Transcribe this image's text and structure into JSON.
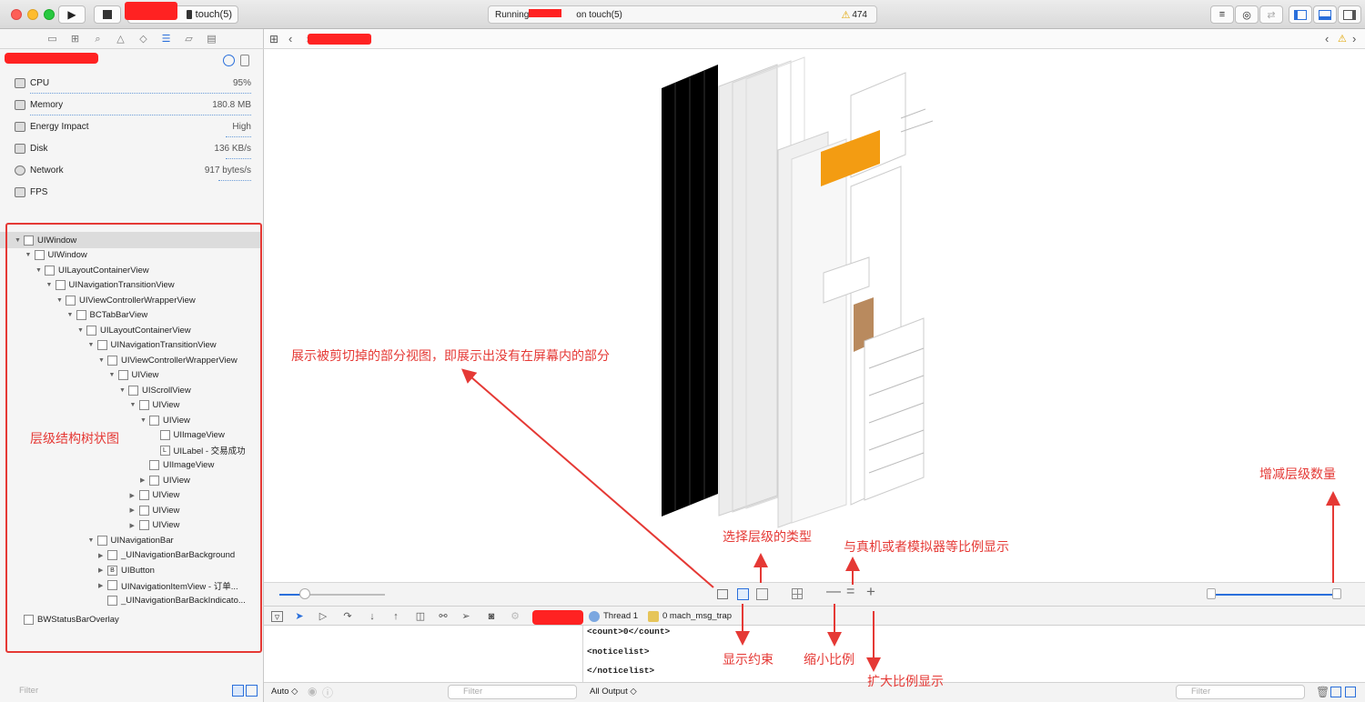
{
  "window": {
    "scheme_device": "touch(5)",
    "status_running": "Running",
    "status_on": "on touch(5)",
    "warning_count": "474"
  },
  "gauges": [
    {
      "label": "CPU",
      "value": "95%"
    },
    {
      "label": "Memory",
      "value": "180.8 MB"
    },
    {
      "label": "Energy Impact",
      "value": "High"
    },
    {
      "label": "Disk",
      "value": "136 KB/s"
    },
    {
      "label": "Network",
      "value": "917 bytes/s"
    },
    {
      "label": "FPS",
      "value": ""
    }
  ],
  "tree": [
    {
      "label": "UIWindow",
      "depth": 0,
      "arrow": "open",
      "box": ""
    },
    {
      "label": "UIWindow",
      "depth": 1,
      "arrow": "open",
      "box": ""
    },
    {
      "label": "UILayoutContainerView",
      "depth": 2,
      "arrow": "open",
      "box": ""
    },
    {
      "label": "UINavigationTransitionView",
      "depth": 3,
      "arrow": "open",
      "box": ""
    },
    {
      "label": "UIViewControllerWrapperView",
      "depth": 4,
      "arrow": "open",
      "box": ""
    },
    {
      "label": "BCTabBarView",
      "depth": 5,
      "arrow": "open",
      "box": ""
    },
    {
      "label": "UILayoutContainerView",
      "depth": 6,
      "arrow": "open",
      "box": ""
    },
    {
      "label": "UINavigationTransitionView",
      "depth": 7,
      "arrow": "open",
      "box": ""
    },
    {
      "label": "UIViewControllerWrapperView",
      "depth": 8,
      "arrow": "open",
      "box": ""
    },
    {
      "label": "UIView",
      "depth": 9,
      "arrow": "open",
      "box": ""
    },
    {
      "label": "UIScrollView",
      "depth": 10,
      "arrow": "open",
      "box": ""
    },
    {
      "label": "UIView",
      "depth": 11,
      "arrow": "open",
      "box": ""
    },
    {
      "label": "UIView",
      "depth": 12,
      "arrow": "open",
      "box": ""
    },
    {
      "label": "UIImageView",
      "depth": 13,
      "arrow": "none",
      "box": ""
    },
    {
      "label": "UILabel - 交易成功",
      "depth": 13,
      "arrow": "none",
      "box": "L"
    },
    {
      "label": "UIImageView",
      "depth": 12,
      "arrow": "none",
      "box": ""
    },
    {
      "label": "UIView",
      "depth": 12,
      "arrow": "closed",
      "box": ""
    },
    {
      "label": "UIView",
      "depth": 11,
      "arrow": "closed",
      "box": ""
    },
    {
      "label": "UIView",
      "depth": 11,
      "arrow": "closed",
      "box": ""
    },
    {
      "label": "UIView",
      "depth": 11,
      "arrow": "closed",
      "box": ""
    },
    {
      "label": "UINavigationBar",
      "depth": 7,
      "arrow": "open",
      "box": ""
    },
    {
      "label": "_UINavigationBarBackground",
      "depth": 8,
      "arrow": "closed",
      "box": ""
    },
    {
      "label": "UIButton",
      "depth": 8,
      "arrow": "closed",
      "box": "B"
    },
    {
      "label": "UINavigationItemView - 订单...",
      "depth": 8,
      "arrow": "closed",
      "box": ""
    },
    {
      "label": "_UINavigationBarBackIndicato...",
      "depth": 8,
      "arrow": "none",
      "box": ""
    },
    {
      "label": "BWStatusBarOverlay",
      "depth": 0,
      "arrow": "none",
      "box": ""
    }
  ],
  "filters": {
    "navigator": "Filter",
    "variables": "Filter",
    "console": "Filter"
  },
  "debug": {
    "thread": "Thread 1",
    "frame": "0 mach_msg_trap",
    "auto": "Auto ◇",
    "all_output": "All Output ◇"
  },
  "console_lines": [
    "<count>0</count>",
    "<noticelist>",
    "</noticelist>"
  ],
  "annotations": {
    "clipped": "展示被剪切掉的部分视图，即展示出没有在屏幕内的部分",
    "tree": "层级结构树状图",
    "layer_count": "增减层级数量",
    "layer_type": "选择层级的类型",
    "actual_size": "与真机或者模拟器等比例显示",
    "constraints": "显示约束",
    "zoom_out": "缩小比例",
    "zoom_in": "扩大比例显示"
  },
  "colors": {
    "annotation": "#e53935",
    "accent": "#2a6fdb",
    "orange_view": "#f39c12"
  }
}
